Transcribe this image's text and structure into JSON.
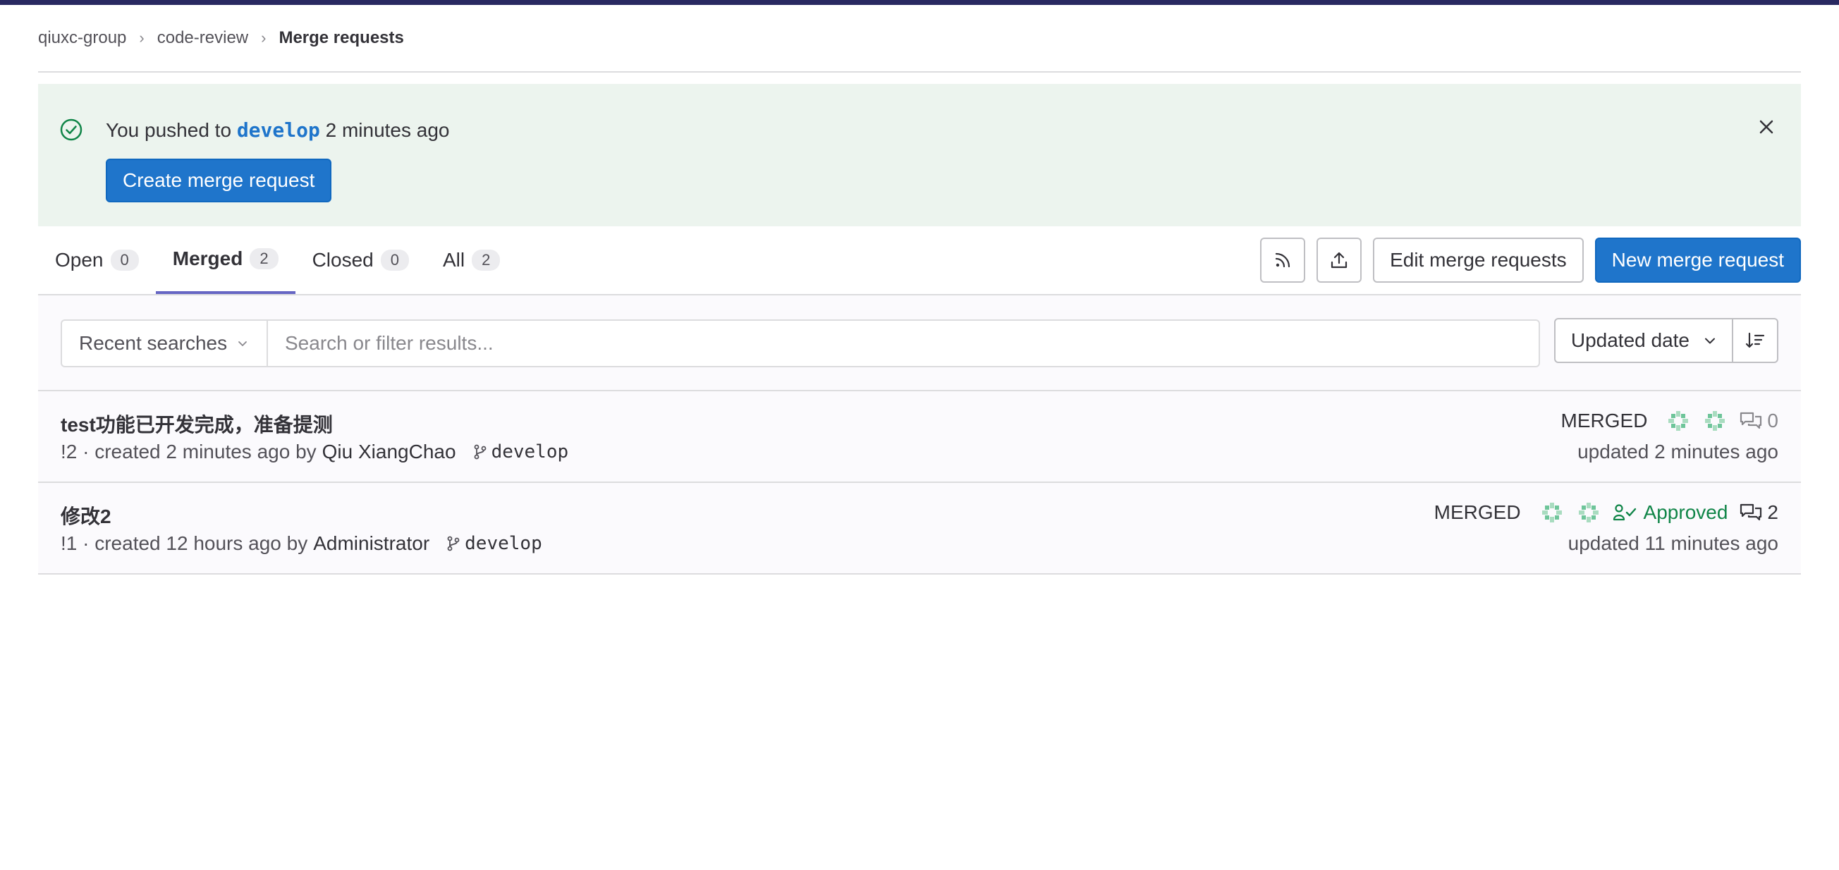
{
  "breadcrumb": {
    "group": "qiuxc-group",
    "project": "code-review",
    "current": "Merge requests"
  },
  "alert": {
    "prefix": "You pushed to",
    "branch": "develop",
    "suffix": "2 minutes ago",
    "button": "Create merge request"
  },
  "tabs": [
    {
      "label": "Open",
      "count": "0"
    },
    {
      "label": "Merged",
      "count": "2"
    },
    {
      "label": "Closed",
      "count": "0"
    },
    {
      "label": "All",
      "count": "2"
    }
  ],
  "actions": {
    "edit": "Edit merge requests",
    "new": "New merge request"
  },
  "filter": {
    "recent": "Recent searches",
    "placeholder": "Search or filter results...",
    "sort": "Updated date"
  },
  "merge_requests": [
    {
      "title": "test功能已开发完成，准备提测",
      "meta": "!2 · created 2 minutes ago by",
      "author": "Qiu XiangChao",
      "branch": "develop",
      "status": "MERGED",
      "approved": "",
      "comments": "0",
      "updated": "updated 2 minutes ago"
    },
    {
      "title": "修改2",
      "meta": "!1 · created 12 hours ago by",
      "author": "Administrator",
      "branch": "develop",
      "status": "MERGED",
      "approved": "Approved",
      "comments": "2",
      "updated": "updated 11 minutes ago"
    }
  ],
  "colors": {
    "primary": "#1f75cb",
    "success": "#108548",
    "alert_bg": "#ecf4ee",
    "active_tab": "#6666c4"
  }
}
